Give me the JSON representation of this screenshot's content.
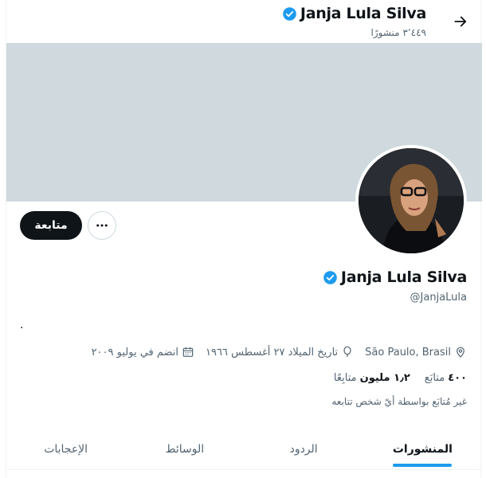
{
  "header": {
    "display_name": "Janja Lula Silva",
    "posts_count": "٣٬٤٤٩ منشورًا",
    "back_icon": "arrow-right-icon"
  },
  "profile": {
    "display_name": "Janja Lula Silva",
    "handle": "@JanjaLula",
    "bio": ".",
    "verified_color": "#1d9bf0",
    "follow_label": "متابعة",
    "more_icon": "more-horizontal-icon",
    "location": "São Paulo, Brasil",
    "birthday": "تاريخ الميلاد ٢٧ أغسطس ١٩٦٦",
    "joined": "انضم في يوليو ٢٠٠٩",
    "following_count": "٤٠٠",
    "following_label": "متابَع",
    "followers_count": "١٫٢ مليون",
    "followers_label": "متابِعًا",
    "not_followed_note": "غير مُتابَع بواسطة أيّ شخص تتابعه"
  },
  "tabs": [
    {
      "label": "المنشورات",
      "active": true
    },
    {
      "label": "الردود",
      "active": false
    },
    {
      "label": "الوسائط",
      "active": false
    },
    {
      "label": "الإعجابات",
      "active": false
    }
  ],
  "colors": {
    "accent": "#1d9bf0",
    "banner": "#cfd9de",
    "text_secondary": "#536471"
  }
}
